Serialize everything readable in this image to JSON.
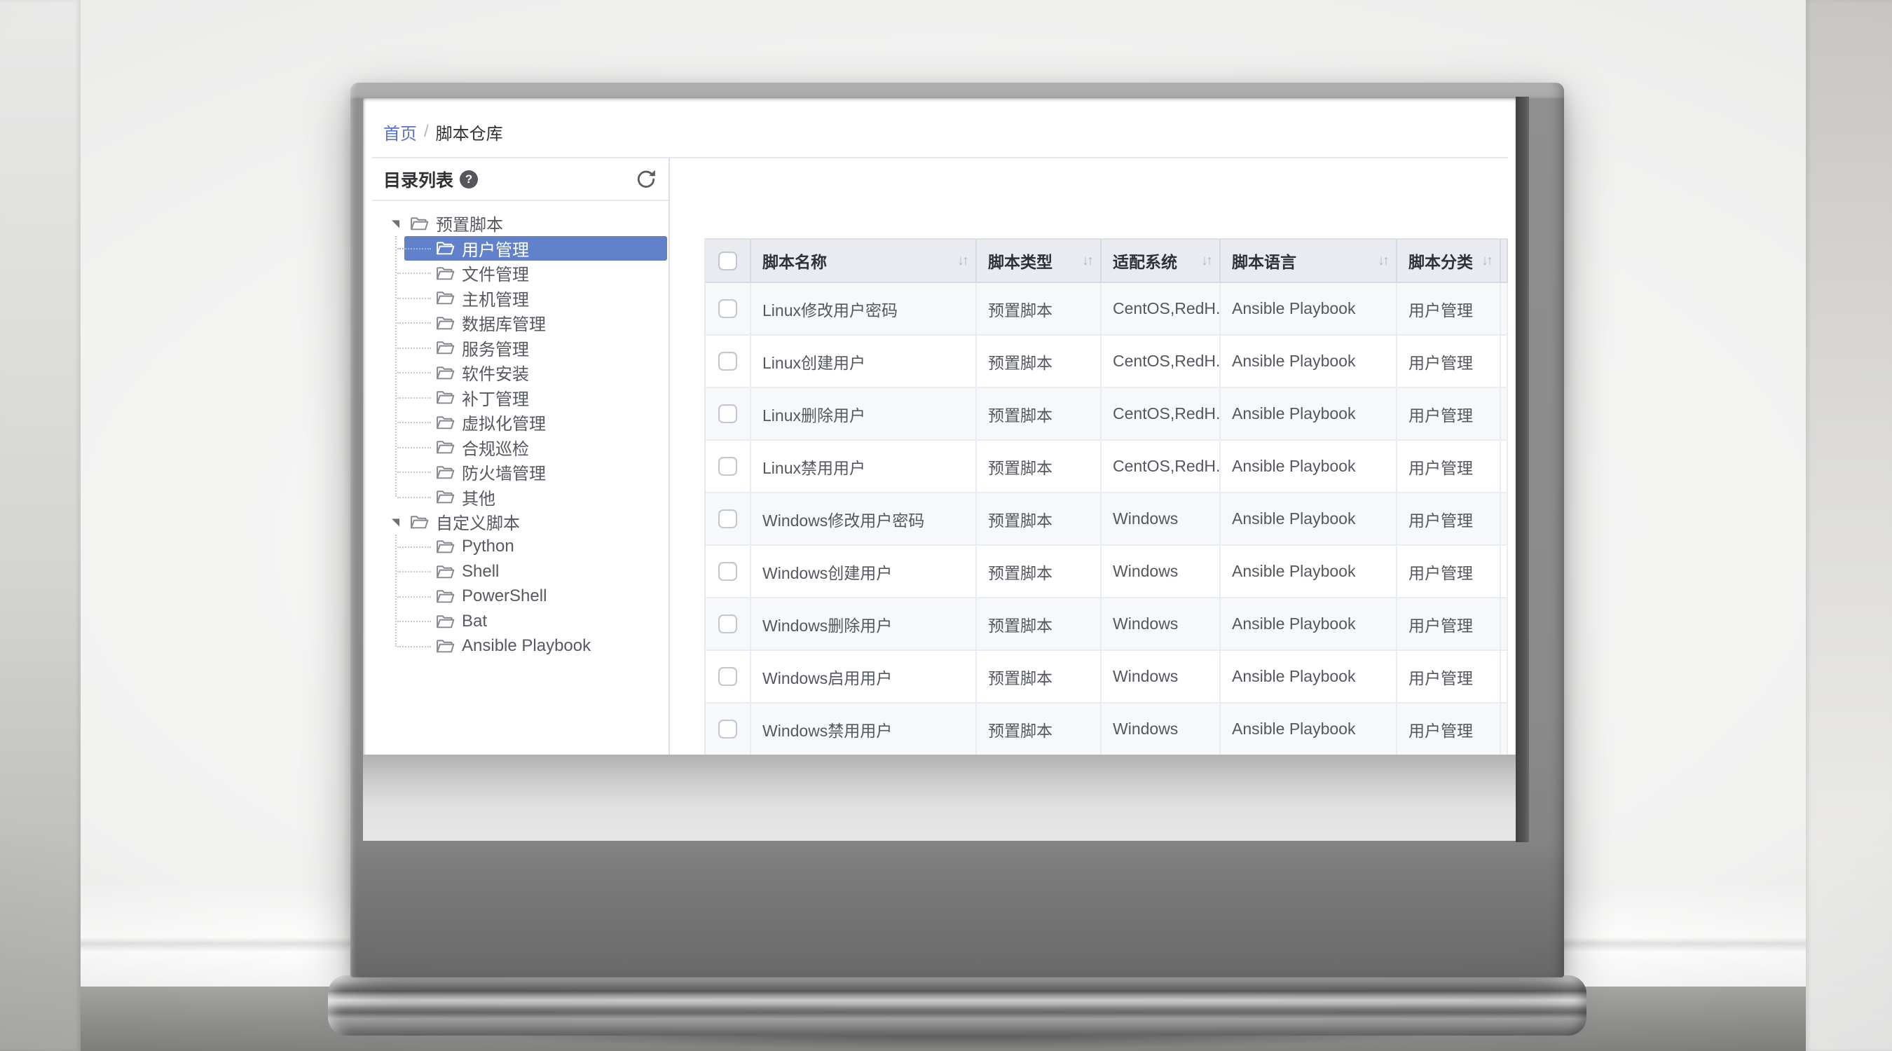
{
  "breadcrumb": {
    "home": "首页",
    "separator": "/",
    "current": "脚本仓库"
  },
  "sidebar": {
    "title": "目录列表",
    "help_glyph": "?",
    "tree": [
      {
        "label": "预置脚本",
        "level": 0,
        "parent": true,
        "selected": false
      },
      {
        "label": "用户管理",
        "level": 1,
        "parent": false,
        "selected": true
      },
      {
        "label": "文件管理",
        "level": 1,
        "parent": false,
        "selected": false
      },
      {
        "label": "主机管理",
        "level": 1,
        "parent": false,
        "selected": false
      },
      {
        "label": "数据库管理",
        "level": 1,
        "parent": false,
        "selected": false
      },
      {
        "label": "服务管理",
        "level": 1,
        "parent": false,
        "selected": false
      },
      {
        "label": "软件安装",
        "level": 1,
        "parent": false,
        "selected": false
      },
      {
        "label": "补丁管理",
        "level": 1,
        "parent": false,
        "selected": false
      },
      {
        "label": "虚拟化管理",
        "level": 1,
        "parent": false,
        "selected": false
      },
      {
        "label": "合规巡检",
        "level": 1,
        "parent": false,
        "selected": false
      },
      {
        "label": "防火墙管理",
        "level": 1,
        "parent": false,
        "selected": false
      },
      {
        "label": "其他",
        "level": 1,
        "parent": false,
        "selected": false
      },
      {
        "label": "自定义脚本",
        "level": 0,
        "parent": true,
        "selected": false
      },
      {
        "label": "Python",
        "level": 1,
        "parent": false,
        "selected": false
      },
      {
        "label": "Shell",
        "level": 1,
        "parent": false,
        "selected": false
      },
      {
        "label": "PowerShell",
        "level": 1,
        "parent": false,
        "selected": false
      },
      {
        "label": "Bat",
        "level": 1,
        "parent": false,
        "selected": false
      },
      {
        "label": "Ansible Playbook",
        "level": 1,
        "parent": false,
        "selected": false
      }
    ]
  },
  "table": {
    "sort_icon": "↓↑",
    "columns": [
      {
        "label": "脚本名称"
      },
      {
        "label": "脚本类型"
      },
      {
        "label": "适配系统"
      },
      {
        "label": "脚本语言"
      },
      {
        "label": "脚本分类"
      }
    ],
    "rows": [
      {
        "name": "Linux修改用户密码",
        "type": "预置脚本",
        "os": "CentOS,RedH...",
        "lang": "Ansible Playbook",
        "category": "用户管理"
      },
      {
        "name": "Linux创建用户",
        "type": "预置脚本",
        "os": "CentOS,RedH...",
        "lang": "Ansible Playbook",
        "category": "用户管理"
      },
      {
        "name": "Linux删除用户",
        "type": "预置脚本",
        "os": "CentOS,RedH...",
        "lang": "Ansible Playbook",
        "category": "用户管理"
      },
      {
        "name": "Linux禁用用户",
        "type": "预置脚本",
        "os": "CentOS,RedH...",
        "lang": "Ansible Playbook",
        "category": "用户管理"
      },
      {
        "name": "Windows修改用户密码",
        "type": "预置脚本",
        "os": "Windows",
        "lang": "Ansible Playbook",
        "category": "用户管理"
      },
      {
        "name": "Windows创建用户",
        "type": "预置脚本",
        "os": "Windows",
        "lang": "Ansible Playbook",
        "category": "用户管理"
      },
      {
        "name": "Windows删除用户",
        "type": "预置脚本",
        "os": "Windows",
        "lang": "Ansible Playbook",
        "category": "用户管理"
      },
      {
        "name": "Windows启用用户",
        "type": "预置脚本",
        "os": "Windows",
        "lang": "Ansible Playbook",
        "category": "用户管理"
      },
      {
        "name": "Windows禁用用户",
        "type": "预置脚本",
        "os": "Windows",
        "lang": "Ansible Playbook",
        "category": "用户管理"
      }
    ]
  },
  "colors": {
    "accent_link": "#5b73c6",
    "tree_selection": "#6182ca",
    "table_header_bg": "#e9ebf1",
    "stripe_row_bg": "#f7f8fa"
  }
}
